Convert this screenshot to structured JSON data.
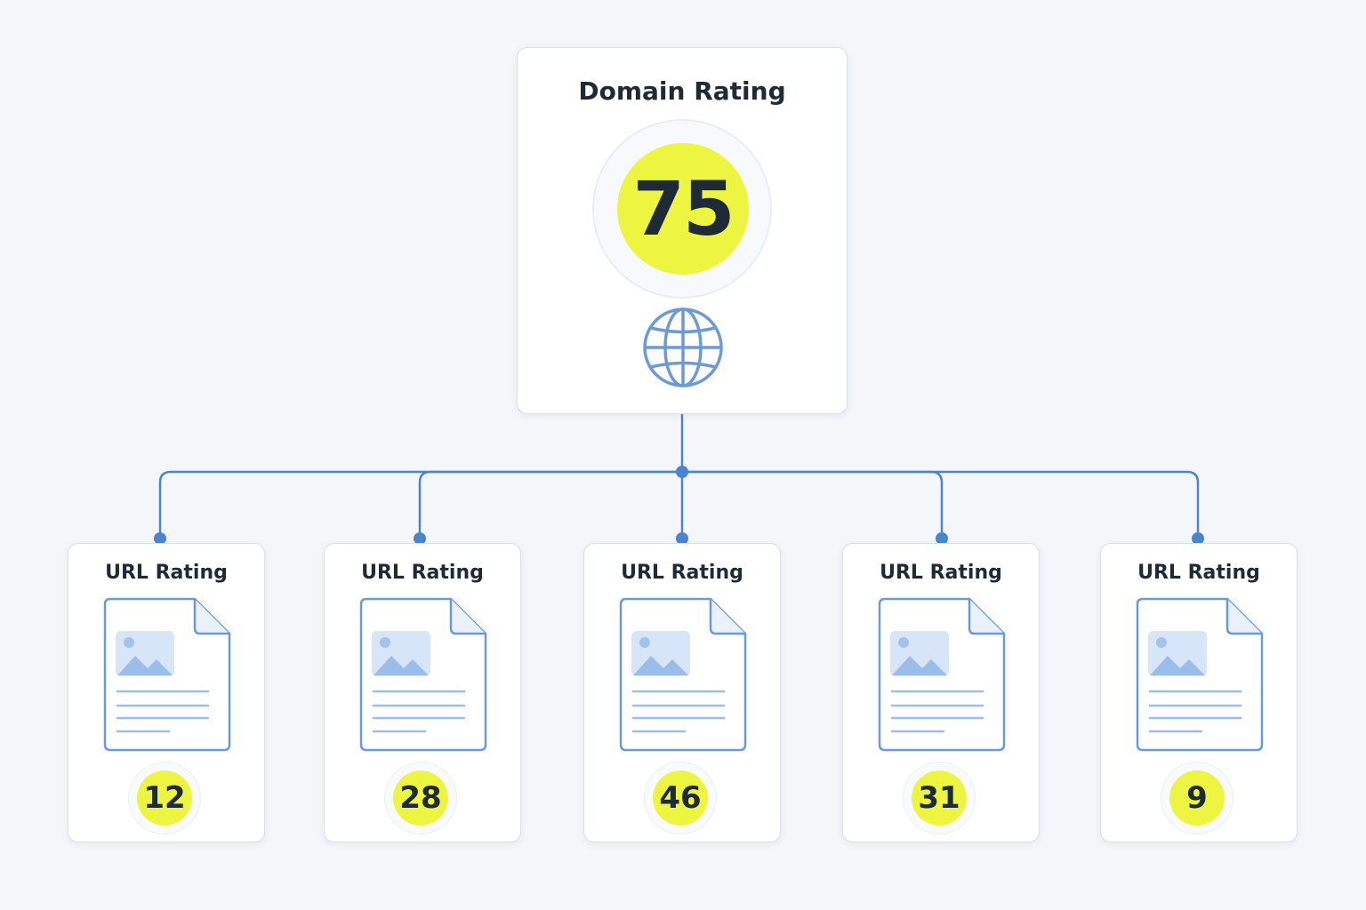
{
  "domain": {
    "title": "Domain Rating",
    "value": "75",
    "icon": "globe-icon"
  },
  "urls": [
    {
      "title": "URL Rating",
      "value": "12",
      "icon": "document-icon"
    },
    {
      "title": "URL Rating",
      "value": "28",
      "icon": "document-icon"
    },
    {
      "title": "URL Rating",
      "value": "46",
      "icon": "document-icon"
    },
    {
      "title": "URL Rating",
      "value": "31",
      "icon": "document-icon"
    },
    {
      "title": "URL Rating",
      "value": "9",
      "icon": "document-icon"
    }
  ],
  "colors": {
    "background": "#f4f6f9",
    "connector": "#4a86d0",
    "score_fill": "#eef540",
    "icon_stroke": "#6b9ad8",
    "text": "#1f2a37"
  }
}
